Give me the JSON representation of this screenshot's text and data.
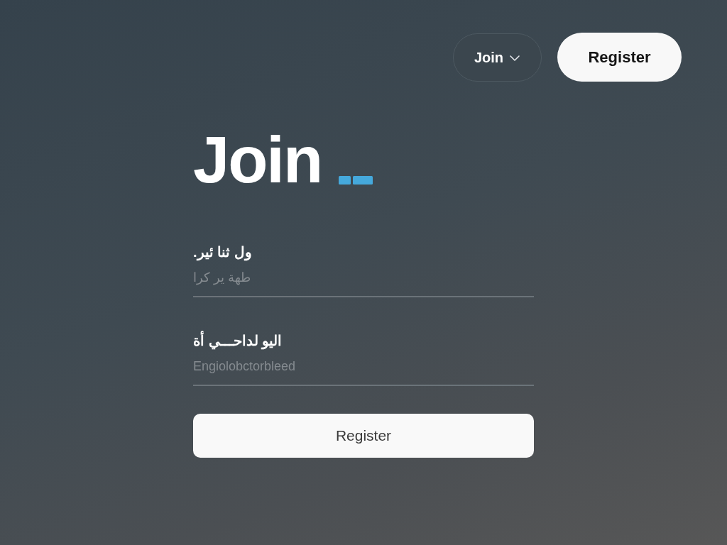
{
  "nav": {
    "join_menu": {
      "label": "Join"
    },
    "register_button": {
      "label": "Register"
    }
  },
  "title": "Join",
  "fields": [
    {
      "label": "ول ثنا ئير.",
      "placeholder": "طهة ير كرا"
    },
    {
      "label": "اليو لداحـــي أة",
      "placeholder": "Engiolobctorbleed"
    }
  ],
  "submit_button": {
    "label": "Register"
  }
}
